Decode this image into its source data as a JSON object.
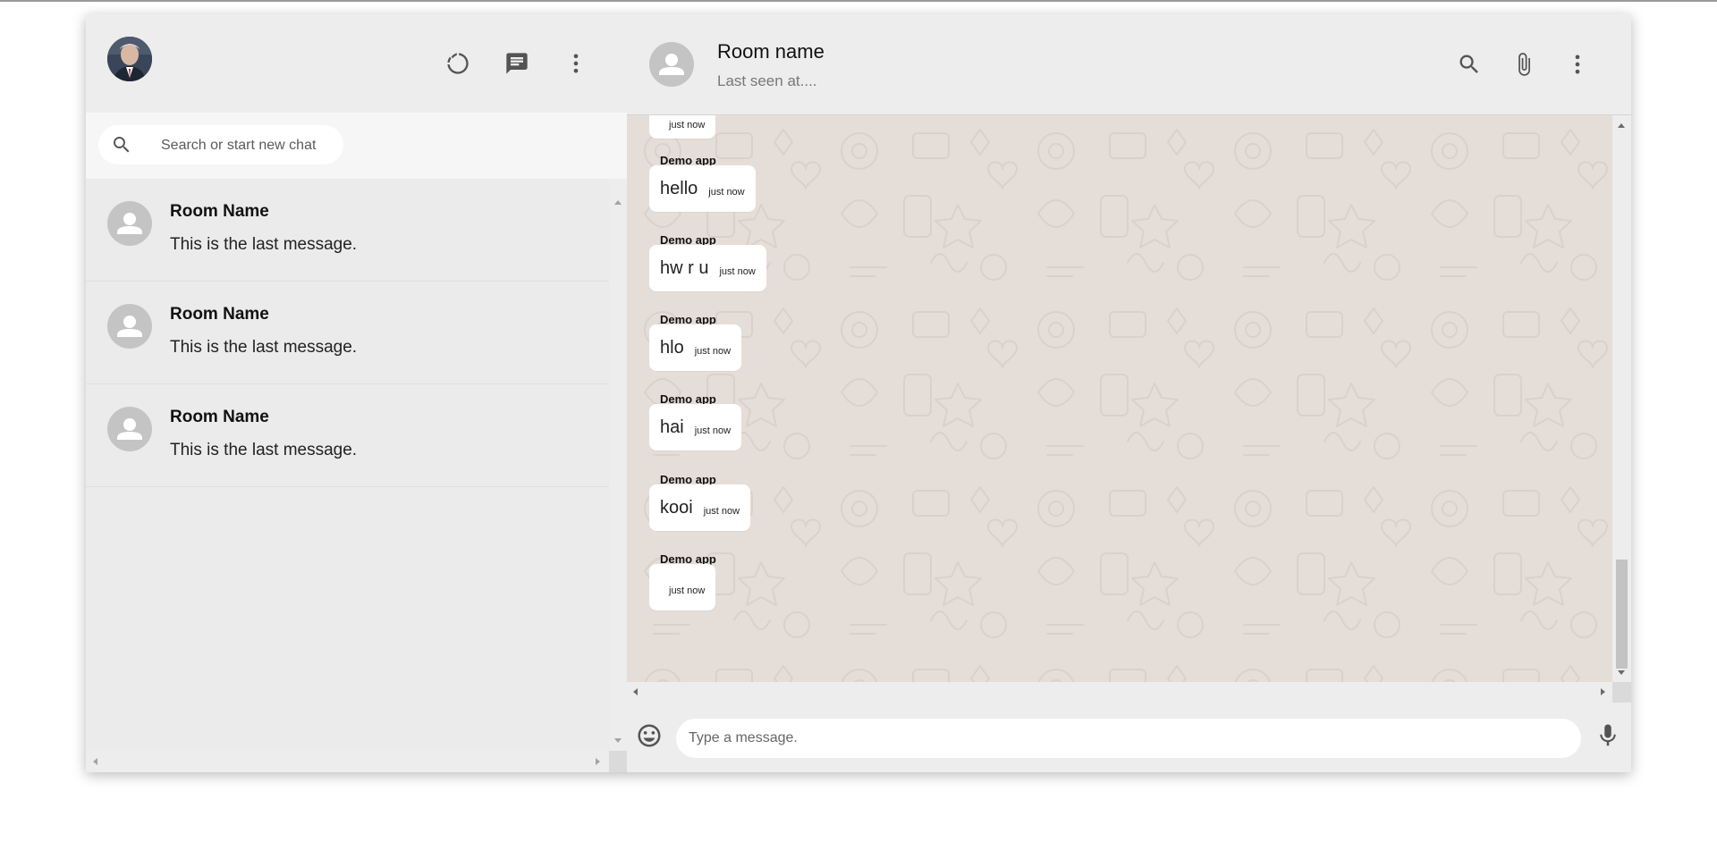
{
  "sidebar": {
    "search": {
      "placeholder": "Search or start new chat"
    },
    "rooms": [
      {
        "name": "Room Name",
        "last_message": "This is the last message."
      },
      {
        "name": "Room Name",
        "last_message": "This is the last message."
      },
      {
        "name": "Room Name",
        "last_message": "This is the last message."
      }
    ],
    "header_icons": [
      "status-icon",
      "new-chat-icon",
      "more-vert-icon"
    ]
  },
  "chat": {
    "header": {
      "title": "Room name",
      "subtitle": "Last seen at....",
      "icons": [
        "search-icon",
        "attach-icon",
        "more-vert-icon"
      ]
    },
    "partial_top_message": {
      "time": "just now"
    },
    "messages": [
      {
        "sender": "Demo app",
        "text": "hello",
        "time": "just now"
      },
      {
        "sender": "Demo app",
        "text": "hw r u",
        "time": "just now"
      },
      {
        "sender": "Demo app",
        "text": "hlo",
        "time": "just now"
      },
      {
        "sender": "Demo app",
        "text": "hai",
        "time": "just now"
      },
      {
        "sender": "Demo app",
        "text": "kooi",
        "time": "just now"
      },
      {
        "sender": "Demo app",
        "text": "",
        "time": "just now"
      }
    ],
    "footer": {
      "placeholder": "Type a message.",
      "icons": [
        "emoji-icon",
        "mic-icon"
      ]
    }
  },
  "colors": {
    "panel_bg": "#ededed",
    "wallpaper_bg": "#e5ded8",
    "bubble_bg": "#ffffff",
    "icon_gray": "#545454",
    "avatar_gray": "#c4c4c4"
  }
}
